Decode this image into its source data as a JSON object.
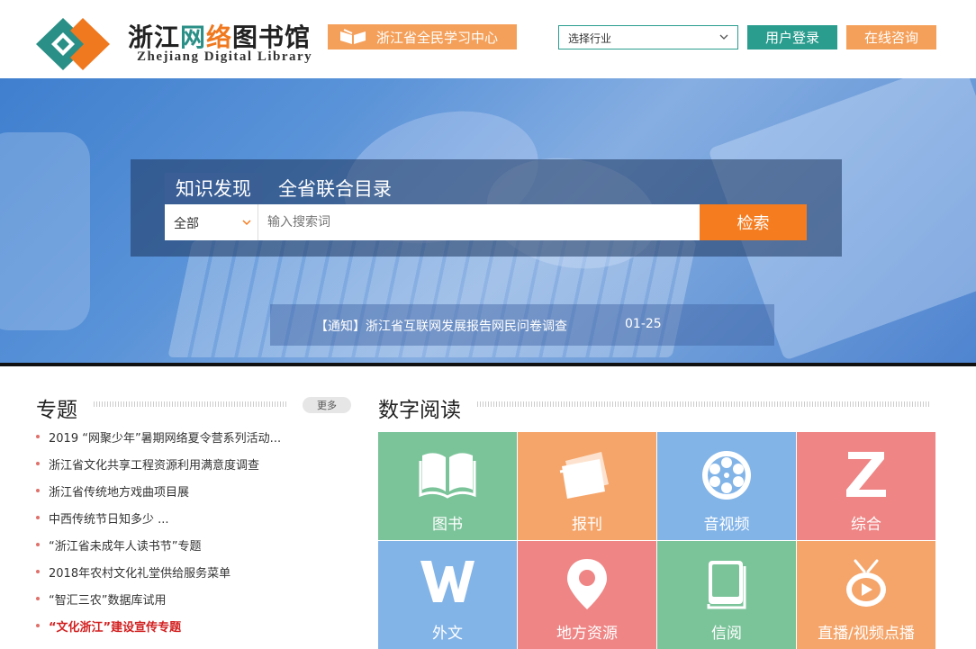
{
  "header": {
    "logo_title_parts": [
      "浙江",
      "网",
      "络",
      "图书馆"
    ],
    "logo_subtitle": "Zhejiang  Digital  Library",
    "learn_center": "浙江省全民学习中心",
    "industry_select": "选择行业",
    "login": "用户登录",
    "consult": "在线咨询"
  },
  "search": {
    "tabs": [
      "知识发现",
      "全省联合目录"
    ],
    "scope": "全部",
    "placeholder": "输入搜索词",
    "button": "检索"
  },
  "notice": {
    "text": "【通知】浙江省互联网发展报告网民问卷调查",
    "date": "01-25"
  },
  "topics": {
    "title": "专题",
    "more": "更多",
    "items": [
      "2019 “网聚少年”暑期网络夏令营系列活动...",
      "浙江省文化共享工程资源利用满意度调查",
      "浙江省传统地方戏曲项目展",
      "中西传统节日知多少 ...",
      "“浙江省未成年人读书节”专题",
      "2018年农村文化礼堂供给服务菜单",
      "“智汇三农”数据库试用",
      "“文化浙江”建设宣传专题"
    ]
  },
  "digital_reading": {
    "title": "数字阅读",
    "tiles": [
      {
        "label": "图书",
        "icon": "book-icon",
        "color": "#7bc49a"
      },
      {
        "label": "报刊",
        "icon": "newspaper-icon",
        "color": "#f5a56a"
      },
      {
        "label": "音视频",
        "icon": "film-reel-icon",
        "color": "#82b4e8"
      },
      {
        "label": "综合",
        "icon": "letter-z-icon",
        "color": "#ef8585"
      },
      {
        "label": "外文",
        "icon": "letter-w-icon",
        "color": "#82b4e8"
      },
      {
        "label": "地方资源",
        "icon": "location-pin-icon",
        "color": "#ef8585"
      },
      {
        "label": "信阅",
        "icon": "closed-book-icon",
        "color": "#7bc49a"
      },
      {
        "label": "直播/视频点播",
        "icon": "tv-play-icon",
        "color": "#f5a56a"
      }
    ]
  },
  "colors": {
    "teal": "#2a9d8f",
    "orange": "#f5a05a",
    "search_orange": "#f57c1f",
    "hot_red": "#d21f1f"
  }
}
